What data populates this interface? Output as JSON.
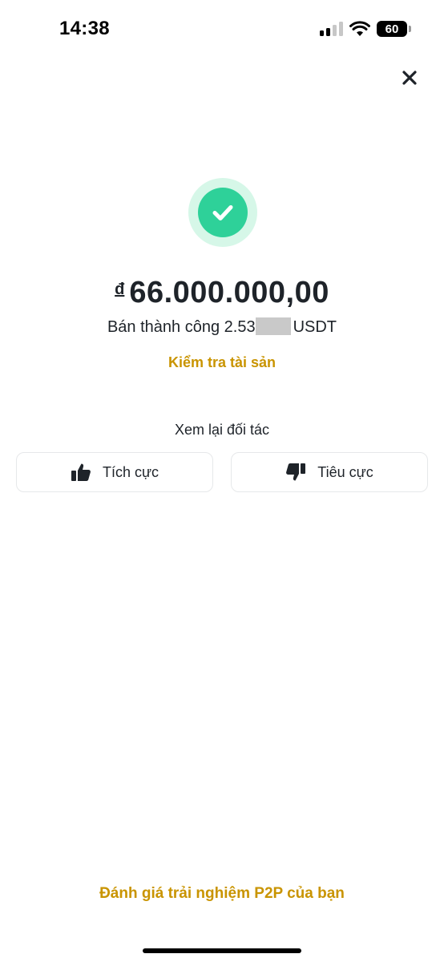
{
  "status_bar": {
    "time": "14:38",
    "battery": "60"
  },
  "icons": {
    "close": "close-icon",
    "success": "check-circle-icon",
    "thumbs_up": "thumbs-up-icon",
    "thumbs_down": "thumbs-down-icon"
  },
  "result": {
    "currency_symbol": "đ",
    "amount": "66.000.000,00",
    "sold_prefix": "Bán thành công 2.53",
    "sold_suffix": "USDT",
    "check_assets_label": "Kiểm tra tài sản"
  },
  "review": {
    "title": "Xem lại đối tác",
    "positive_label": "Tích cực",
    "negative_label": "Tiêu cực"
  },
  "footer": {
    "rate_experience_label": "Đánh giá trải nghiệm P2P của bạn"
  },
  "colors": {
    "accent": "#c99400",
    "success": "#2ed199",
    "success_halo": "#d6f7e8",
    "text": "#1e2329"
  }
}
